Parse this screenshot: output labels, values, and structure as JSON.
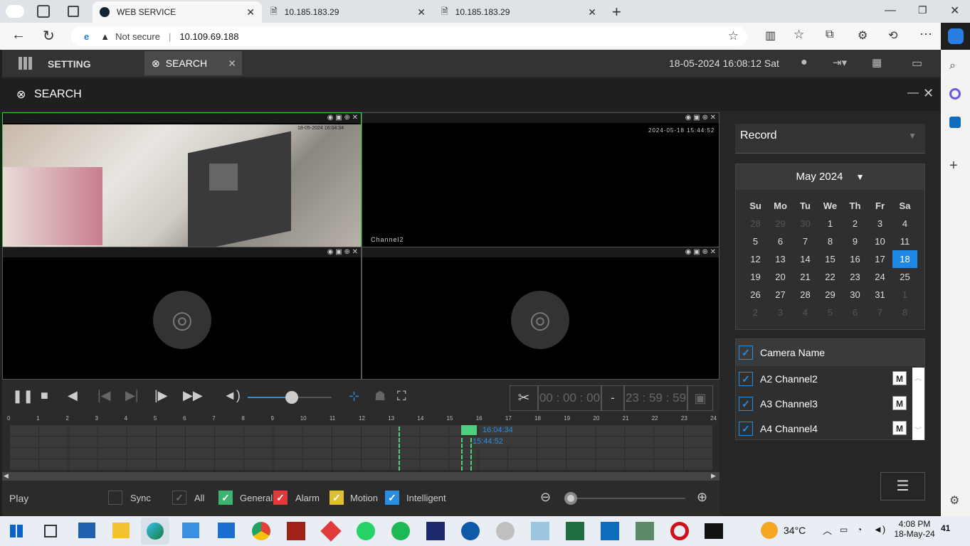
{
  "browser": {
    "tabs": [
      {
        "label": "WEB SERVICE"
      },
      {
        "label": "10.185.183.29"
      },
      {
        "label": "10.185.183.29"
      }
    ],
    "security": "Not secure",
    "url": "10.109.69.188"
  },
  "app": {
    "setting_label": "SETTING",
    "search_tab_label": "SEARCH",
    "datetime": "18-05-2024 16:08:12 Sat",
    "panel_title": "SEARCH"
  },
  "video": {
    "channel2_label": "Channel2",
    "ch1_timestamp": "18-05-2024 16:04:34",
    "ch2_timestamp": "2024-05-18 15:44:52"
  },
  "controls": {
    "start_time": "00 : 00 : 00",
    "separator": "-",
    "end_time": "23 : 59 : 59"
  },
  "timeline": {
    "hours": [
      "0",
      "1",
      "2",
      "3",
      "4",
      "5",
      "6",
      "7",
      "8",
      "9",
      "10",
      "11",
      "12",
      "13",
      "14",
      "15",
      "16",
      "17",
      "18",
      "19",
      "20",
      "21",
      "22",
      "23",
      "24"
    ],
    "marker1": "16:04:34",
    "marker2": "15:44:52"
  },
  "legend": {
    "mode": "Play",
    "sync": "Sync",
    "all": "All",
    "general": "General",
    "alarm": "Alarm",
    "motion": "Motion",
    "intelligent": "Intelligent"
  },
  "right": {
    "record_type": "Record",
    "month": "May 2024",
    "weekdays": [
      "Su",
      "Mo",
      "Tu",
      "We",
      "Th",
      "Fr",
      "Sa"
    ],
    "weeks": [
      [
        "28",
        "29",
        "30",
        "1",
        "2",
        "3",
        "4"
      ],
      [
        "5",
        "6",
        "7",
        "8",
        "9",
        "10",
        "11"
      ],
      [
        "12",
        "13",
        "14",
        "15",
        "16",
        "17",
        "18"
      ],
      [
        "19",
        "20",
        "21",
        "22",
        "23",
        "24",
        "25"
      ],
      [
        "26",
        "27",
        "28",
        "29",
        "30",
        "31",
        "1"
      ],
      [
        "2",
        "3",
        "4",
        "5",
        "6",
        "7",
        "8"
      ]
    ],
    "selected_day": "18",
    "camera_header": "Camera Name",
    "cameras": [
      {
        "name": "A2 Channel2",
        "badge": "M"
      },
      {
        "name": "A3 Channel3",
        "badge": "M"
      },
      {
        "name": "A4 Channel4",
        "badge": "M"
      }
    ]
  },
  "taskbar": {
    "temperature": "34°C",
    "time": "4:08 PM",
    "date": "18-May-24",
    "notifications": "41"
  },
  "colors": {
    "accent": "#1e88e5",
    "general": "#3cb371",
    "alarm": "#e03a3a",
    "motion": "#e0c030",
    "intelligent": "#2a8ee0",
    "record_green": "#4cd080"
  }
}
